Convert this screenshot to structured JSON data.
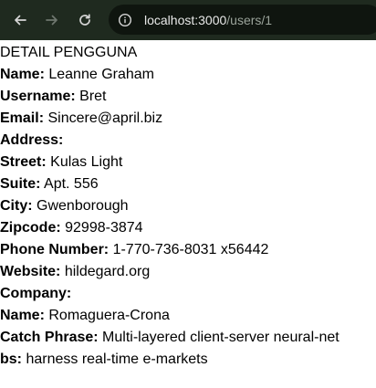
{
  "browser": {
    "url_host": "localhost:3000",
    "url_path": "/users/1",
    "icons": {
      "back": "back-arrow-icon",
      "forward": "forward-arrow-icon",
      "reload": "reload-icon",
      "info": "site-info-icon"
    },
    "colors": {
      "toolbar_bg": "#1f2a1f",
      "omnibox_bg": "#0f150f"
    }
  },
  "page": {
    "heading": "DETAIL PENGGUNA",
    "fields": [
      {
        "label": "Name:",
        "value": "Leanne Graham"
      },
      {
        "label": "Username:",
        "value": "Bret"
      },
      {
        "label": "Email:",
        "value": "Sincere@april.biz"
      },
      {
        "label": "Address:",
        "value": ""
      },
      {
        "label": "Street:",
        "value": "Kulas Light"
      },
      {
        "label": "Suite:",
        "value": "Apt. 556"
      },
      {
        "label": "City:",
        "value": "Gwenborough"
      },
      {
        "label": "Zipcode:",
        "value": "92998-3874"
      },
      {
        "label": "Phone Number:",
        "value": "1-770-736-8031 x56442"
      },
      {
        "label": "Website:",
        "value": "hildegard.org"
      },
      {
        "label": "Company:",
        "value": ""
      },
      {
        "label": "Name:",
        "value": "Romaguera-Crona"
      },
      {
        "label": "Catch Phrase:",
        "value": "Multi-layered client-server neural-net"
      },
      {
        "label": "bs:",
        "value": "harness real-time e-markets"
      }
    ]
  }
}
